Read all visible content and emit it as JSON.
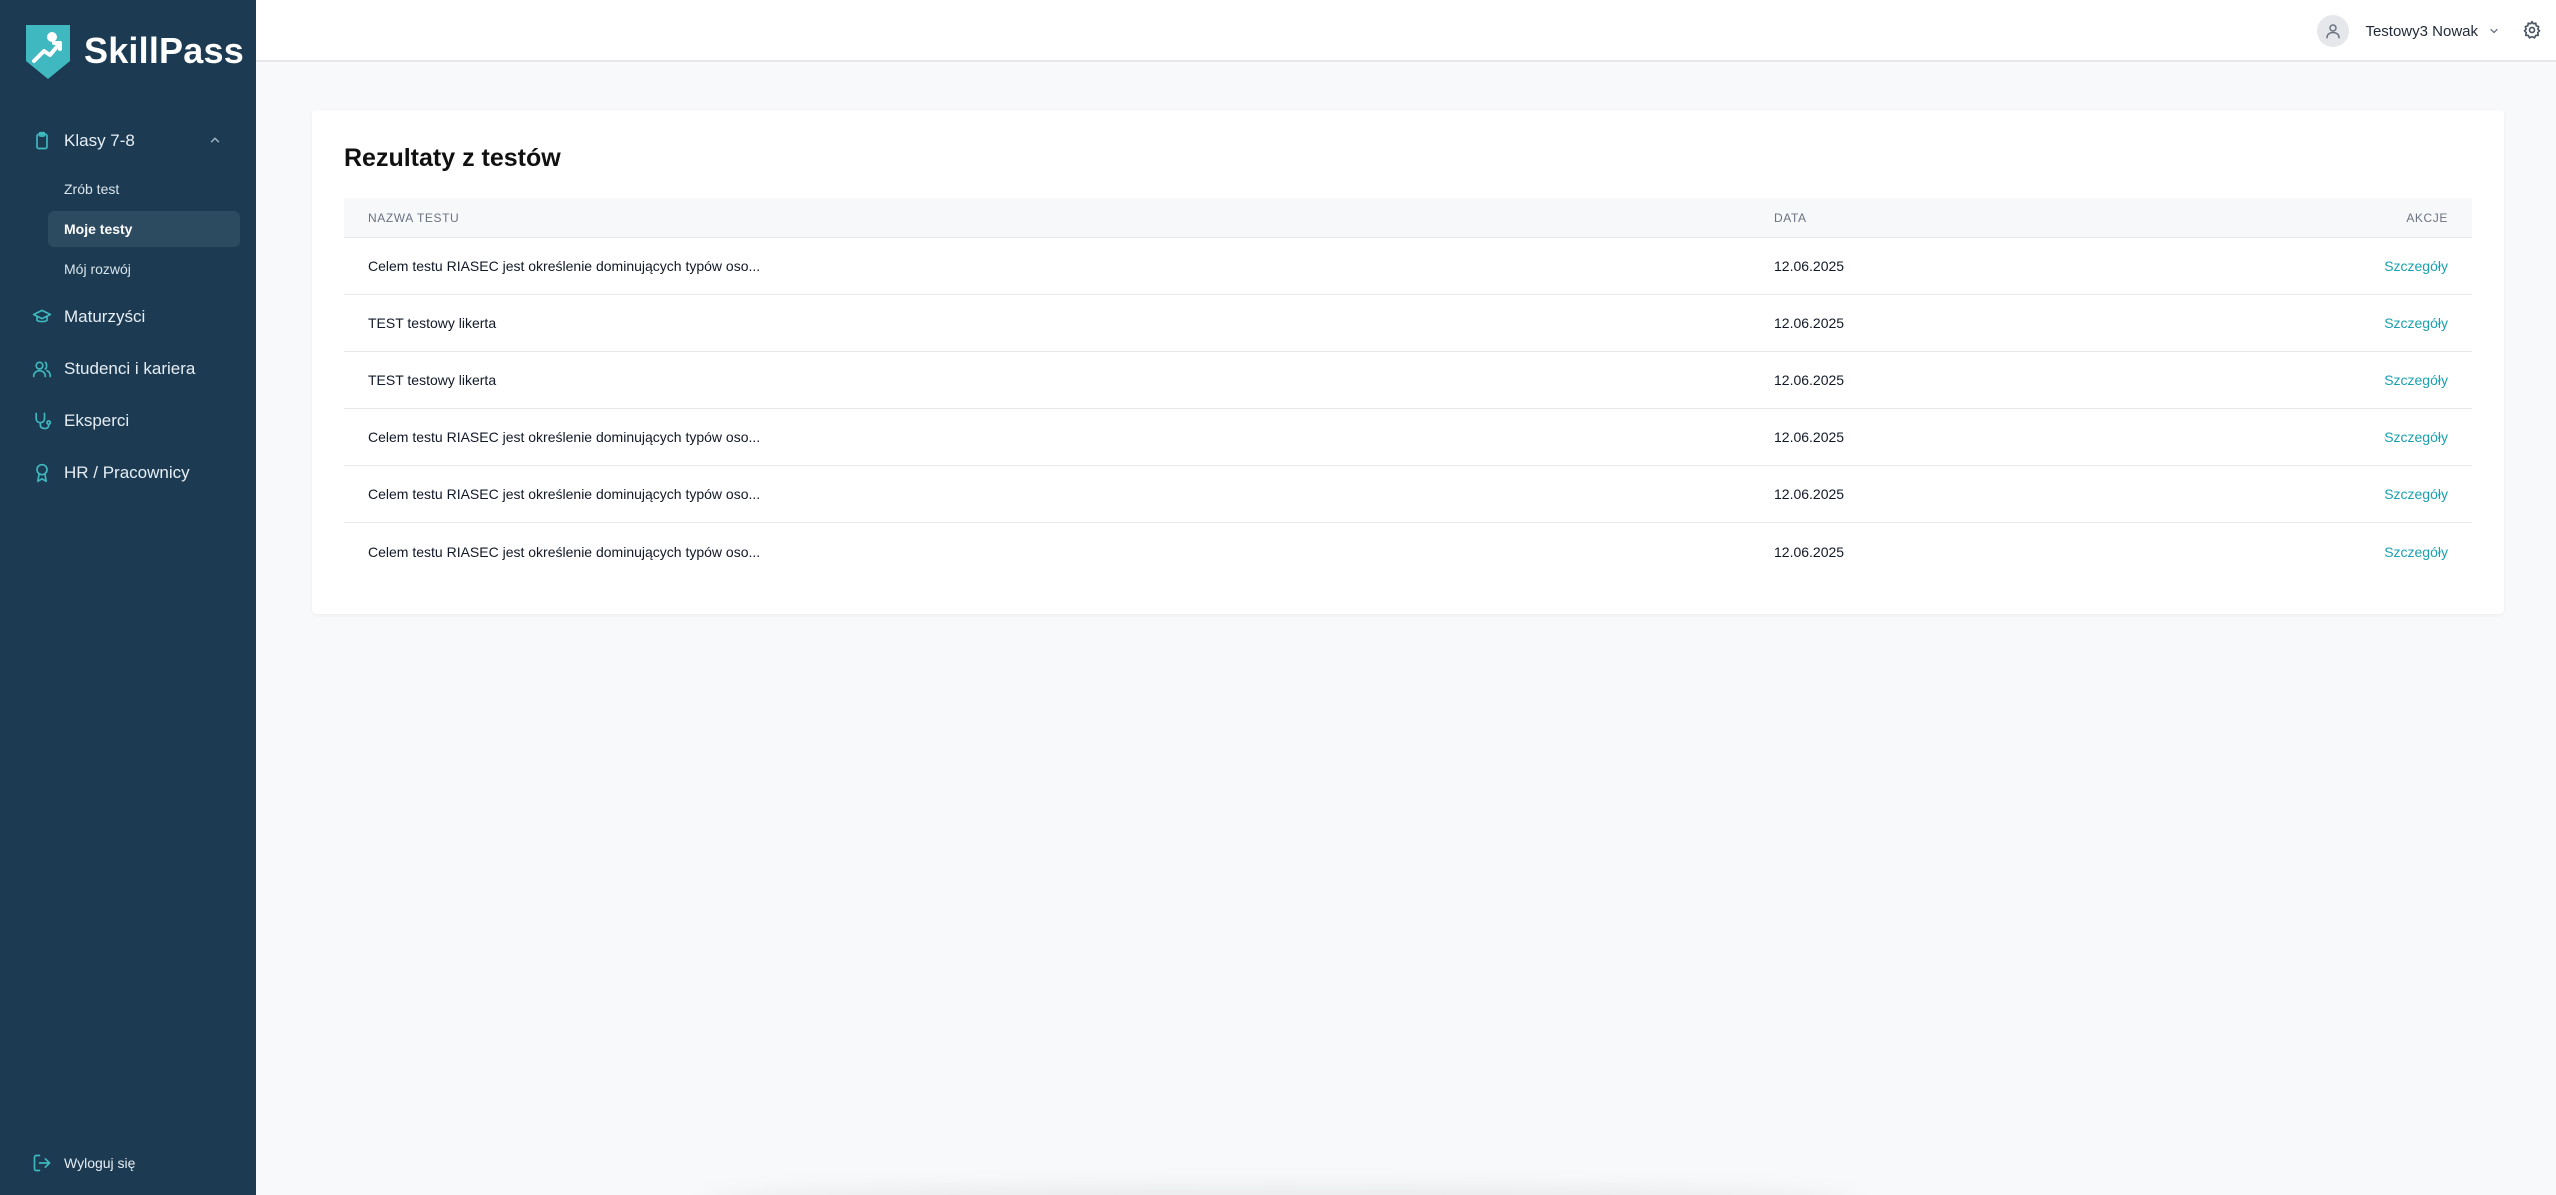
{
  "brand": {
    "name": "SkillPass"
  },
  "sidebar": {
    "section": {
      "label": "Klasy 7-8",
      "icon": "clipboard-icon"
    },
    "sub_items": [
      {
        "label": "Zrób test",
        "active": false
      },
      {
        "label": "Moje testy",
        "active": true
      },
      {
        "label": "Mój rozwój",
        "active": false
      }
    ],
    "items": [
      {
        "label": "Maturzyści",
        "icon": "graduation-cap-icon"
      },
      {
        "label": "Studenci i kariera",
        "icon": "users-icon"
      },
      {
        "label": "Eksperci",
        "icon": "stethoscope-icon"
      },
      {
        "label": "HR / Pracownicy",
        "icon": "award-icon"
      }
    ],
    "logout_label": "Wyloguj się"
  },
  "topbar": {
    "user_name": "Testowy3 Nowak"
  },
  "card": {
    "title": "Rezultaty z testów",
    "headers": {
      "name": "NAZWA TESTU",
      "date": "DATA",
      "actions": "AKCJE"
    },
    "rows": [
      {
        "name": "Celem testu RIASEC jest określenie dominujących typów oso...",
        "date": "12.06.2025",
        "action": "Szczegóły"
      },
      {
        "name": "TEST testowy likerta",
        "date": "12.06.2025",
        "action": "Szczegóły"
      },
      {
        "name": "TEST testowy likerta",
        "date": "12.06.2025",
        "action": "Szczegóły"
      },
      {
        "name": "Celem testu RIASEC jest określenie dominujących typów oso...",
        "date": "12.06.2025",
        "action": "Szczegóły"
      },
      {
        "name": "Celem testu RIASEC jest określenie dominujących typów oso...",
        "date": "12.06.2025",
        "action": "Szczegóły"
      },
      {
        "name": "Celem testu RIASEC jest określenie dominujących typów oso...",
        "date": "12.06.2025",
        "action": "Szczegóły"
      }
    ]
  },
  "colors": {
    "sidebar_bg": "#1c3b52",
    "accent": "#19a0b0",
    "icon_teal": "#3fb8bf"
  }
}
